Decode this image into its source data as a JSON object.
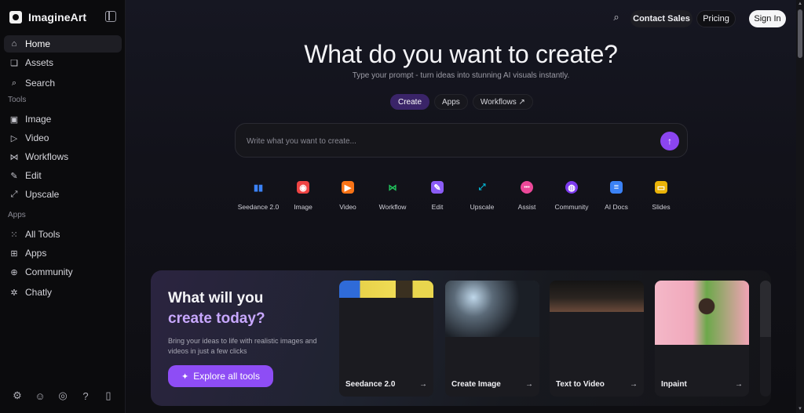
{
  "app": {
    "name": "ImagineArt"
  },
  "sidebar": {
    "items_top": [
      {
        "label": "Home",
        "icon": "home-icon"
      },
      {
        "label": "Assets",
        "icon": "assets-icon"
      },
      {
        "label": "Search",
        "icon": "search-icon"
      }
    ],
    "tools_label": "Tools",
    "tools": [
      {
        "label": "Image",
        "icon": "image-icon"
      },
      {
        "label": "Video",
        "icon": "video-icon"
      },
      {
        "label": "Workflows",
        "icon": "workflows-icon"
      },
      {
        "label": "Edit",
        "icon": "edit-icon"
      },
      {
        "label": "Upscale",
        "icon": "upscale-icon"
      }
    ],
    "apps_label": "Apps",
    "apps": [
      {
        "label": "All Tools",
        "icon": "grid-icon"
      },
      {
        "label": "Apps",
        "icon": "apps-icon"
      },
      {
        "label": "Community",
        "icon": "globe-icon"
      },
      {
        "label": "Chatly",
        "icon": "chatly-icon"
      }
    ],
    "footer_icons": [
      "settings-icon",
      "discord-icon",
      "reddit-icon",
      "help-icon",
      "mobile-icon"
    ]
  },
  "header": {
    "contact_sales": "Contact Sales",
    "pricing": "Pricing",
    "sign_in": "Sign In"
  },
  "hero": {
    "title": "What do you want to create?",
    "subtitle": "Type your prompt - turn ideas into stunning AI visuals instantly.",
    "tabs": [
      "Create",
      "Apps",
      "Workflows ↗"
    ],
    "prompt_placeholder": "Write what you want to create..."
  },
  "tools": [
    {
      "label": "Seedance 2.0",
      "color": "#3b82f6",
      "glyph": "▮▮"
    },
    {
      "label": "Image",
      "color": "#ef4444",
      "glyph": "◉"
    },
    {
      "label": "Video",
      "color": "#f97316",
      "glyph": "▶"
    },
    {
      "label": "Workflow",
      "color": "#22c55e",
      "glyph": "⋈"
    },
    {
      "label": "Edit",
      "color": "#8b5cf6",
      "glyph": "✎"
    },
    {
      "label": "Upscale",
      "color": "#06b6d4",
      "glyph": "⤢"
    },
    {
      "label": "Assist",
      "color": "#ec4899",
      "glyph": "•••"
    },
    {
      "label": "Community",
      "color": "#7c3aed",
      "glyph": "◍"
    },
    {
      "label": "AI Docs",
      "color": "#3b82f6",
      "glyph": "≡"
    },
    {
      "label": "Slides",
      "color": "#eab308",
      "glyph": "▭"
    }
  ],
  "banner": {
    "title_line1": "What will you",
    "title_line2": "create today?",
    "description": "Bring your ideas to life with realistic images and videos in just a few clicks",
    "cta": "Explore all tools",
    "cards": [
      {
        "label": "Seedance 2.0",
        "arrow": "→"
      },
      {
        "label": "Create Image",
        "arrow": "→"
      },
      {
        "label": "Text to Video",
        "arrow": "→"
      },
      {
        "label": "Inpaint",
        "arrow": "→"
      }
    ]
  },
  "colors": {
    "accent": "#8e4df5",
    "active_tab": "#3a2468"
  }
}
